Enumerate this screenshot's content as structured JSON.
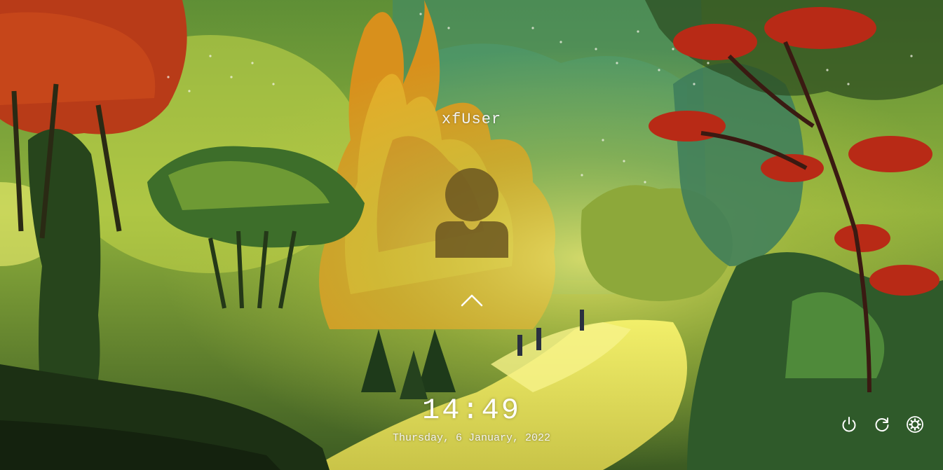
{
  "lock_screen": {
    "username": "xfUser",
    "time": "14:49",
    "date": "Thursday, 6 January, 2022"
  },
  "icons": {
    "avatar": "user-silhouette-icon",
    "expand": "chevron-up-icon",
    "power": "power-icon",
    "restart": "restart-icon",
    "settings": "gear-icon"
  },
  "colors": {
    "text": "#ffffff",
    "avatar_fill": "#6b5620"
  }
}
